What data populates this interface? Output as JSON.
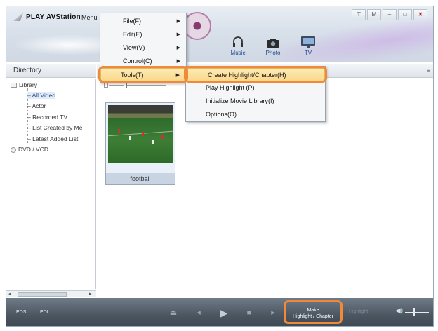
{
  "app": {
    "title": "PLAY AVStation",
    "menu_label": "Menu",
    "window_controls": [
      "⊤",
      "M",
      "–",
      "□",
      "✕"
    ]
  },
  "media_tabs": [
    {
      "label": "Music",
      "icon": "headphones-icon"
    },
    {
      "label": "Photo",
      "icon": "camera-icon"
    },
    {
      "label": "TV",
      "icon": "tv-icon"
    }
  ],
  "directory": {
    "header": "Directory",
    "items": [
      {
        "label": "Library",
        "icon": "library-icon"
      },
      {
        "label": "All Video",
        "selected": true
      },
      {
        "label": "Actor"
      },
      {
        "label": "Recorded TV"
      },
      {
        "label": "List Created by Me"
      },
      {
        "label": "Latest Added List"
      },
      {
        "label": "DVD / VCD",
        "icon": "disc-icon"
      }
    ]
  },
  "content": {
    "items": [
      {
        "label": "football"
      }
    ]
  },
  "main_menu": {
    "items": [
      {
        "label": "File(F)"
      },
      {
        "label": "Edit(E)"
      },
      {
        "label": "View(V)"
      },
      {
        "label": "Control(C)"
      },
      {
        "label": "Tools(T)",
        "highlighted": true
      }
    ]
  },
  "tools_menu": {
    "items": [
      {
        "label": "Create Highlight/Chapter(H)",
        "highlighted": true
      },
      {
        "label": "Play Highlight (P)"
      },
      {
        "label": "Initialize Movie Library(I)"
      },
      {
        "label": "Options(O)"
      }
    ]
  },
  "bottom_bar": {
    "eds": "EDS",
    "edi": "EDI",
    "make_line1": "Make",
    "make_line2": "Highlight / Chapter",
    "highlight": "Highlight"
  },
  "colors": {
    "callout": "#f08a3a",
    "menu_highlight": "#f9d98a",
    "bottom_bar": "#4a5560"
  }
}
